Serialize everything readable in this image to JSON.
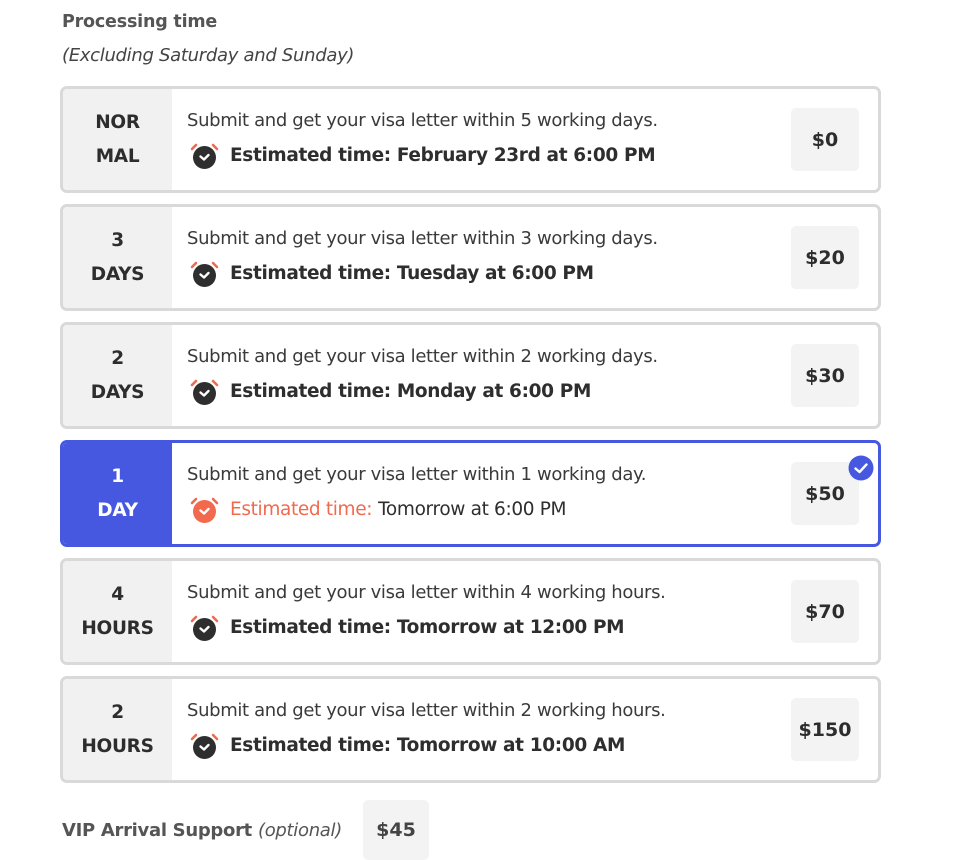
{
  "section": {
    "title": "Processing time",
    "subtitle": "(Excluding Saturday and Sunday)"
  },
  "colors": {
    "accent": "#4758e0",
    "eta_highlight": "#f16a4e",
    "clock_dark": "#2e2e2e",
    "border": "#d9d9d9"
  },
  "options": [
    {
      "label_line1": "NOR",
      "label_line2": "MAL",
      "description": "Submit and get your visa letter within 5 working days.",
      "eta_label": "Estimated time:",
      "eta_value": "February 23rd at 6:00 PM",
      "price": "$0",
      "icon": "alarm-clock-icon",
      "selected": false
    },
    {
      "label_line1": "3",
      "label_line2": "DAYS",
      "description": "Submit and get your visa letter within 3 working days.",
      "eta_label": "Estimated time:",
      "eta_value": "Tuesday at 6:00 PM",
      "price": "$20",
      "icon": "alarm-clock-icon",
      "selected": false
    },
    {
      "label_line1": "2",
      "label_line2": "DAYS",
      "description": "Submit and get your visa letter within 2 working days.",
      "eta_label": "Estimated time:",
      "eta_value": "Monday at 6:00 PM",
      "price": "$30",
      "icon": "alarm-clock-icon",
      "selected": false
    },
    {
      "label_line1": "1",
      "label_line2": "DAY",
      "description": "Submit and get your visa letter within 1 working day.",
      "eta_label": "Estimated time:",
      "eta_value": "Tomorrow at 6:00 PM",
      "price": "$50",
      "icon": "alarm-clock-icon",
      "selected": true
    },
    {
      "label_line1": "4",
      "label_line2": "HOURS",
      "description": "Submit and get your visa letter within 4 working hours.",
      "eta_label": "Estimated time:",
      "eta_value": "Tomorrow at 12:00 PM",
      "price": "$70",
      "icon": "alarm-clock-icon",
      "selected": false
    },
    {
      "label_line1": "2",
      "label_line2": "HOURS",
      "description": "Submit and get your visa letter within 2 working hours.",
      "eta_label": "Estimated time:",
      "eta_value": "Tomorrow at 10:00 AM",
      "price": "$150",
      "icon": "alarm-clock-icon",
      "selected": false
    }
  ],
  "vip": {
    "label": "VIP Arrival Support",
    "optional": "(optional)",
    "price": "$45"
  }
}
